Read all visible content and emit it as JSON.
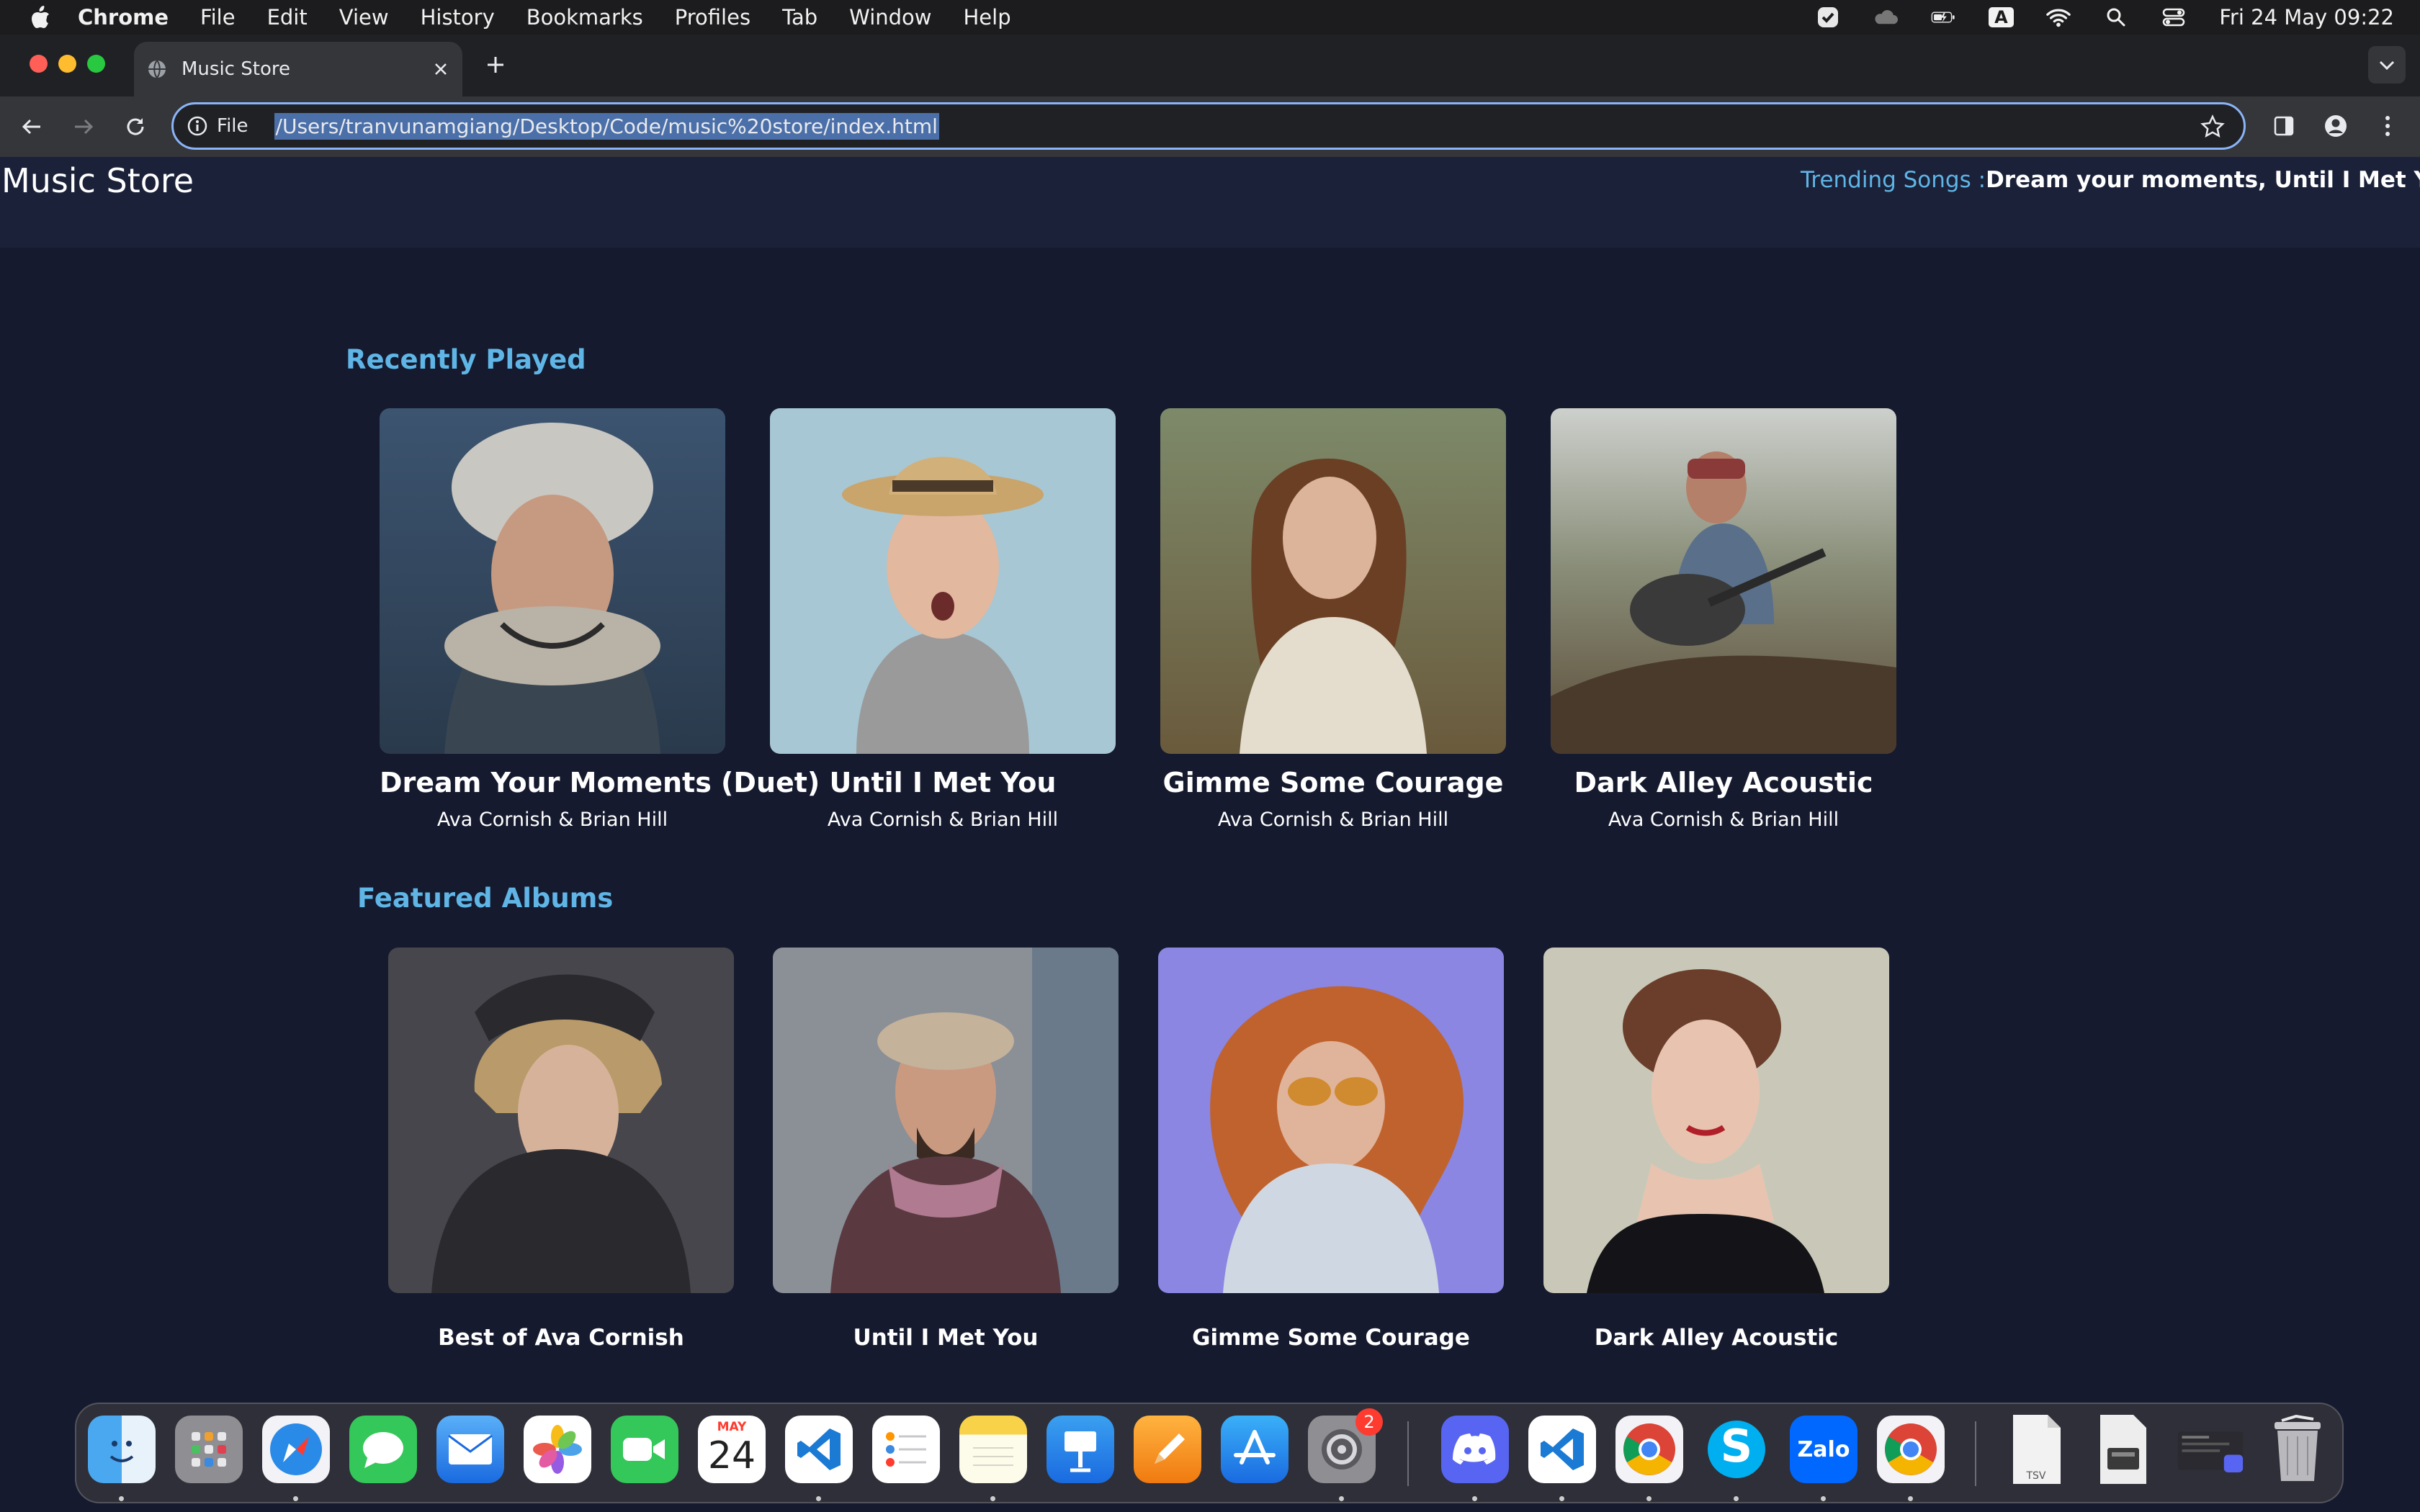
{
  "menubar": {
    "app_name": "Chrome",
    "items": [
      "File",
      "Edit",
      "View",
      "History",
      "Bookmarks",
      "Profiles",
      "Tab",
      "Window",
      "Help"
    ],
    "input_indicator": "A",
    "clock": "Fri 24 May  09:22"
  },
  "browser": {
    "tab_title": "Music Store",
    "scheme_label": "File",
    "url": "/Users/tranvunamgiang/Desktop/Code/music%20store/index.html"
  },
  "site": {
    "logo": "Music Store",
    "trending_label": "Trending Songs :",
    "trending_list": "Dream your moments, Until I Met You, Gim"
  },
  "recently_played": {
    "title": "Recently Played",
    "items": [
      {
        "title": "Dream Your Moments (Duet)",
        "artist": "Ava Cornish & Brian Hill"
      },
      {
        "title": "Until I Met You",
        "artist": "Ava Cornish & Brian Hill"
      },
      {
        "title": "Gimme Some Courage",
        "artist": "Ava Cornish & Brian Hill"
      },
      {
        "title": "Dark Alley Acoustic",
        "artist": "Ava Cornish & Brian Hill"
      }
    ]
  },
  "featured_albums": {
    "title": "Featured Albums",
    "items": [
      {
        "title": "Best of Ava Cornish"
      },
      {
        "title": "Until I Met You"
      },
      {
        "title": "Gimme Some Courage"
      },
      {
        "title": "Dark Alley Acoustic"
      }
    ]
  },
  "dock": {
    "calendar_month": "MAY",
    "calendar_day": "24",
    "settings_badge": "2",
    "zalo_label": "Zalo",
    "skype_label": "S",
    "tsv_label": "TSV"
  }
}
